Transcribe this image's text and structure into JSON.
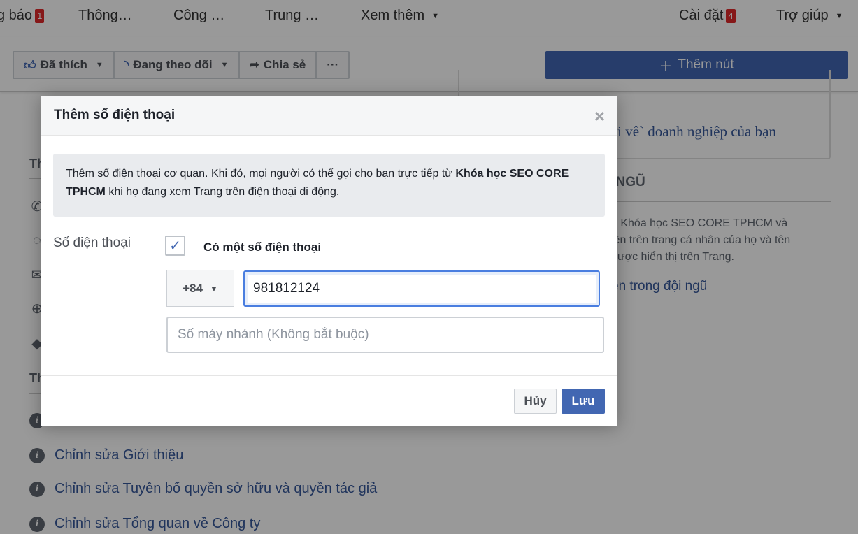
{
  "topnav": {
    "items": [
      {
        "label": "g báo",
        "badge": "1"
      },
      {
        "label": "Thông…"
      },
      {
        "label": "Công …"
      },
      {
        "label": "Trung …"
      },
      {
        "label": "Xem thêm"
      }
    ],
    "settings": {
      "label": "Cài đặt",
      "badge": "4"
    },
    "help": {
      "label": "Trợ giúp"
    }
  },
  "actionbar": {
    "liked": "Đã thích",
    "following": "Đang theo dõi",
    "share": "Chia sẻ",
    "more": "···",
    "add_button": "Thêm nút"
  },
  "background": {
    "left_items": [
      "Chỉnh sửa Giới thiệu",
      "Chỉnh sửa Tuyên bố quyền sở hữu và quyền tác giả",
      "Chỉnh sửa Tổng quan về Công ty"
    ],
    "left_heading_1": "Th",
    "left_heading_2": "Th",
    "right_box_text": "ời vê` doanh nghiệp của bạn",
    "right_heading": "I NGŨ",
    "right_para": [
      "g Khóa học SEO CORE TPHCM và",
      "iện trên trang cá nhân của họ và tên",
      "được hiển thị trên Trang."
    ],
    "right_link": "ện trong đội ngũ"
  },
  "modal": {
    "title": "Thêm số điện thoại",
    "info_prefix": "Thêm số điện thoại cơ quan. Khi đó, mọi người có thể gọi cho bạn trực tiếp từ ",
    "info_page": "Khóa học SEO CORE TPHCM",
    "info_suffix": " khi họ đang xem Trang trên điện thoại di động.",
    "field_label": "Số điện thoại",
    "checkbox_label": "Có một số điện thoại",
    "checkbox_checked": true,
    "country_code": "+84",
    "phone_value": "981812124",
    "extension_placeholder": "Số máy nhánh (Không bắt buộc)",
    "cancel": "Hủy",
    "save": "Lưu"
  },
  "colors": {
    "accent": "#4267b2",
    "badge": "#e0282b",
    "link": "#365899"
  }
}
